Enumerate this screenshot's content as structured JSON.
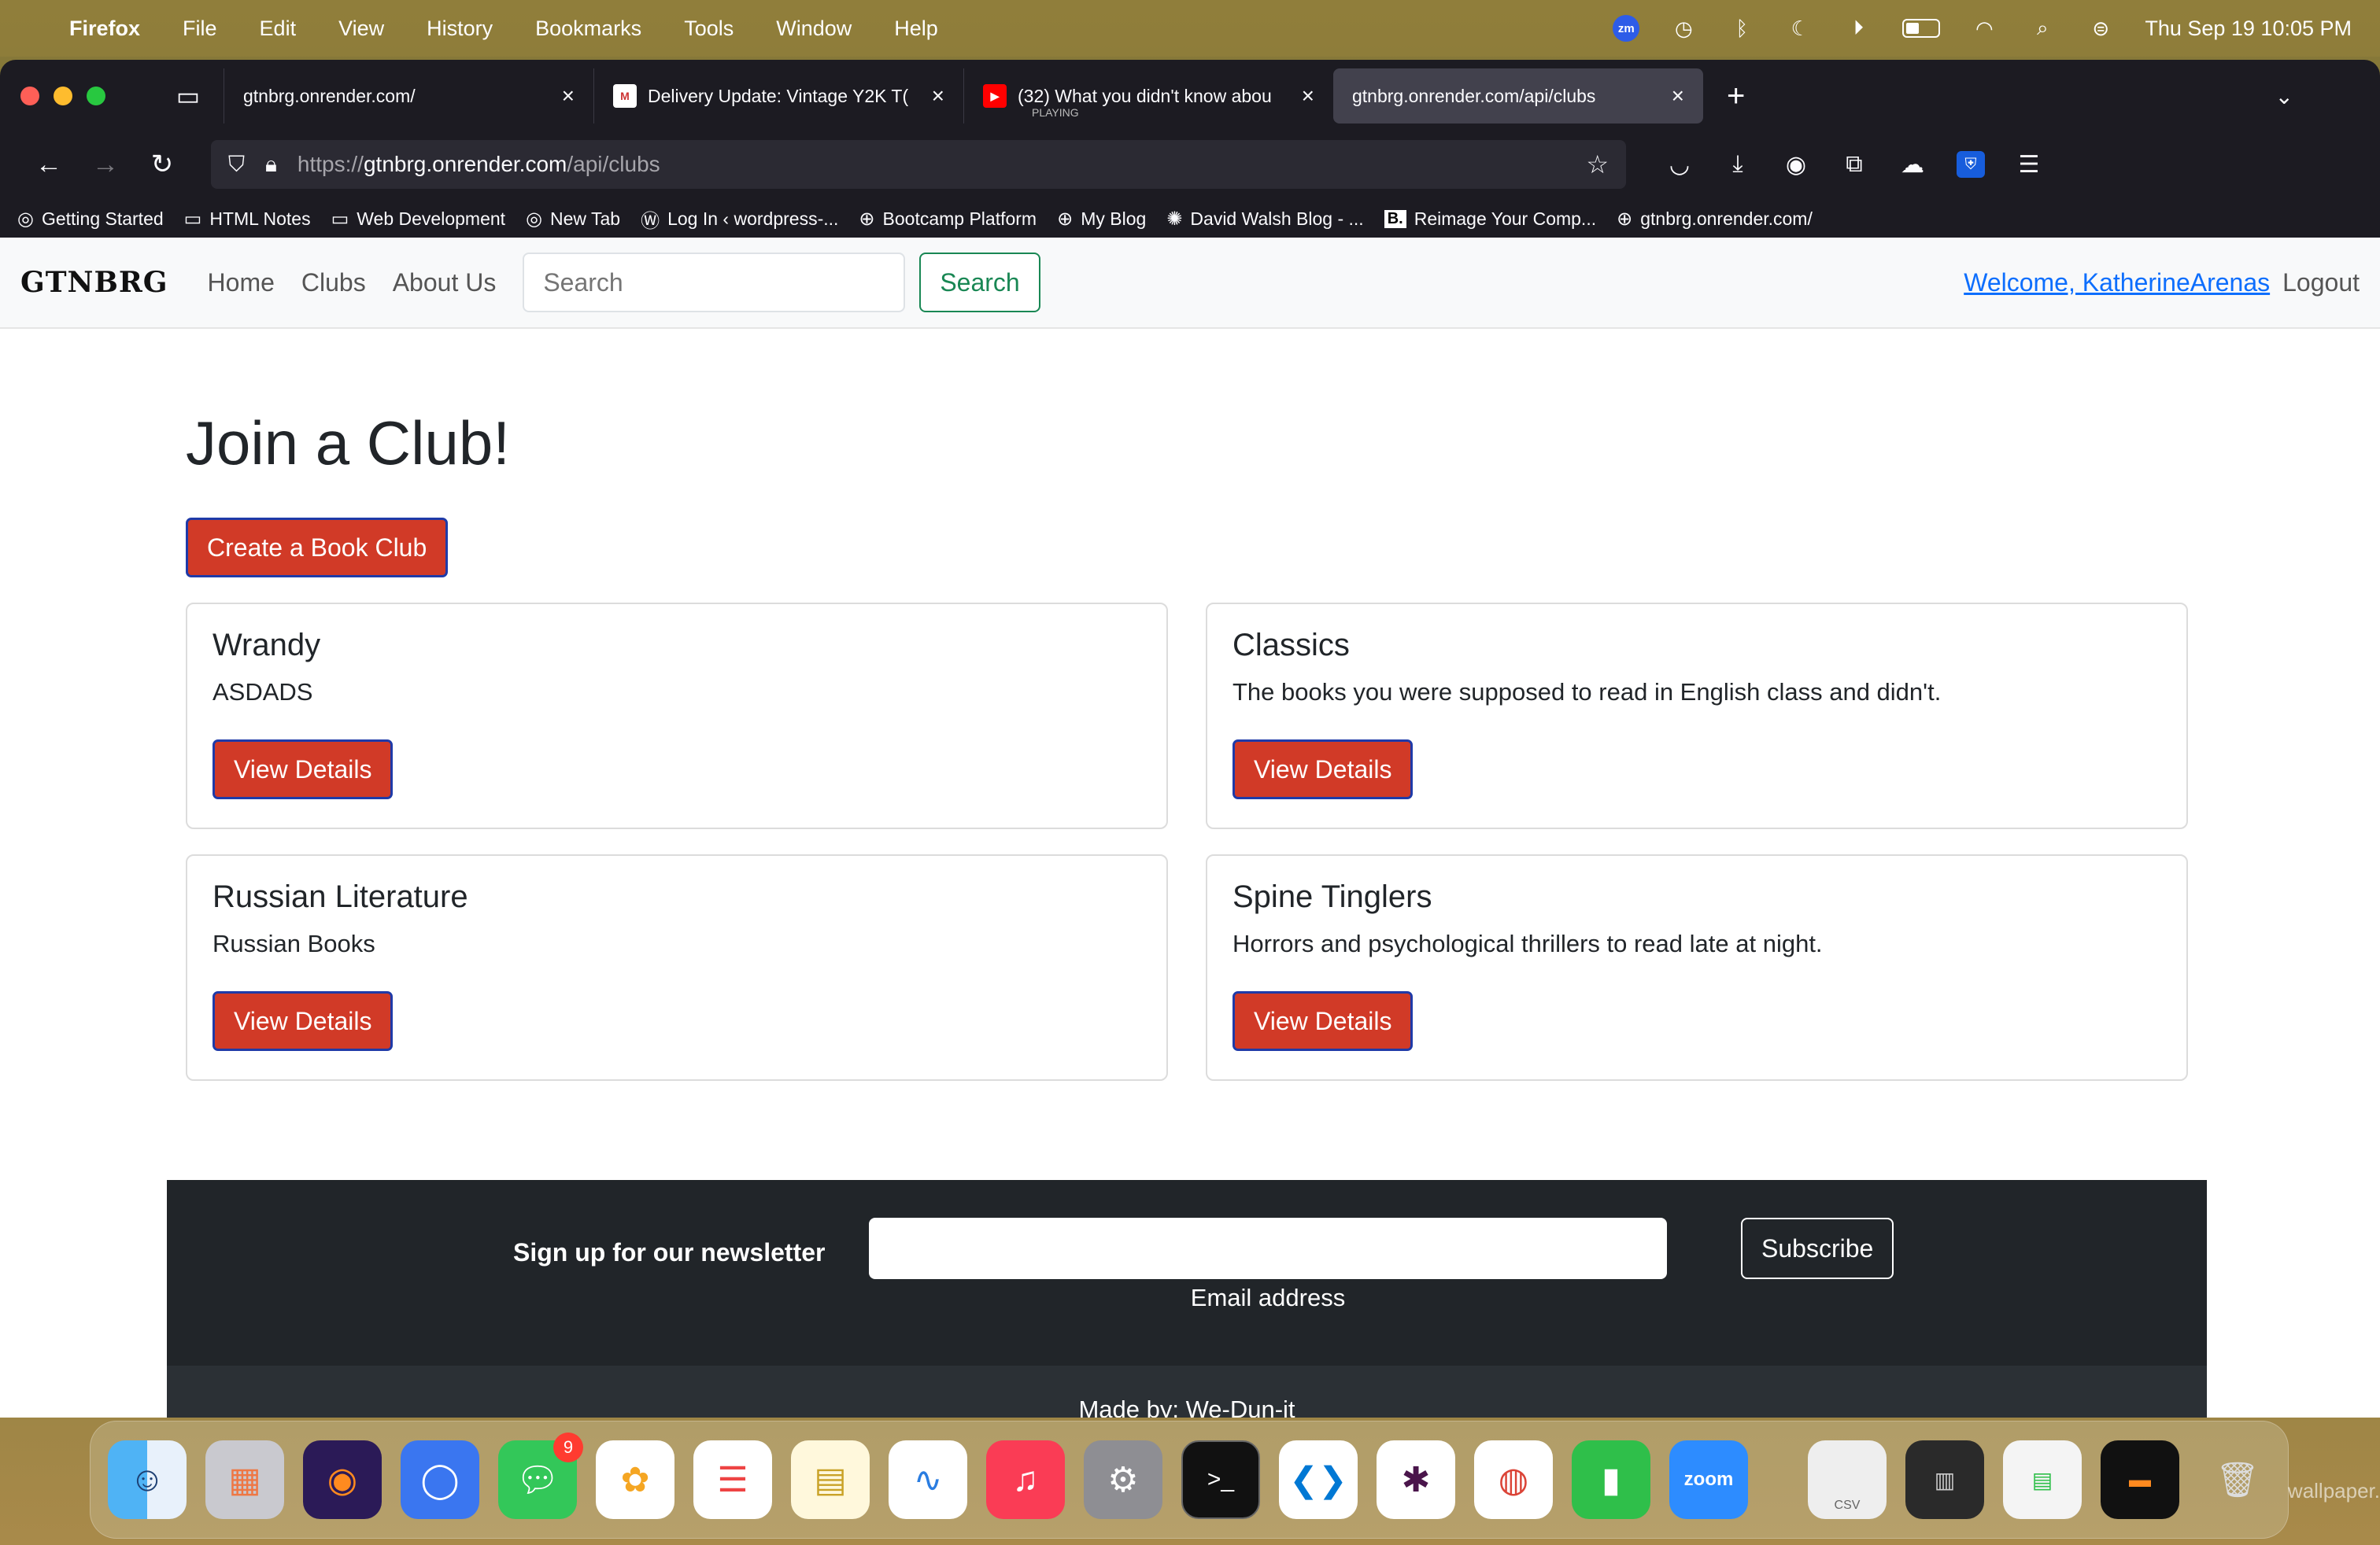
{
  "menubar": {
    "app": "Firefox",
    "items": [
      "File",
      "Edit",
      "View",
      "History",
      "Bookmarks",
      "Tools",
      "Window",
      "Help"
    ],
    "datetime": "Thu Sep 19  10:05 PM",
    "zoom_badge": "zm"
  },
  "browser": {
    "tabs": [
      {
        "title": "gtnbrg.onrender.com/",
        "sub": ""
      },
      {
        "title": "Delivery Update: Vintage Y2K T(",
        "sub": ""
      },
      {
        "title": "(32) What you didn't know abou",
        "sub": "PLAYING"
      },
      {
        "title": "gtnbrg.onrender.com/api/clubs",
        "sub": ""
      }
    ],
    "url": {
      "scheme": "https://",
      "host": "gtnbrg.onrender.com",
      "path": "/api/clubs"
    },
    "bookmarks": [
      "Getting Started",
      "HTML Notes",
      "Web Development",
      "New Tab",
      "Log In ‹ wordpress-...",
      "Bootcamp Platform",
      "My Blog",
      "David Walsh Blog - ...",
      "Reimage Your Comp...",
      "gtnbrg.onrender.com/"
    ]
  },
  "site": {
    "brand": "GTNBRG",
    "nav": {
      "home": "Home",
      "clubs": "Clubs",
      "about": "About Us"
    },
    "search": {
      "placeholder": "Search",
      "button": "Search"
    },
    "welcome": "Welcome, KatherineArenas",
    "logout": "Logout",
    "page_title": "Join a Club!",
    "create_button": "Create a Book Club",
    "clubs": [
      {
        "name": "Wrandy",
        "description": "ASDADS",
        "button": "View Details"
      },
      {
        "name": "Classics",
        "description": "The books you were supposed to read in English class and didn't.",
        "button": "View Details"
      },
      {
        "name": "Russian Literature",
        "description": "Russian Books",
        "button": "View Details"
      },
      {
        "name": "Spine Tinglers",
        "description": "Horrors and psychological thrillers to read late at night.",
        "button": "View Details"
      }
    ],
    "footer": {
      "newsletter_label": "Sign up for our newsletter",
      "email_help": "Email address",
      "subscribe": "Subscribe",
      "made_by": "Made by: We-Dun-it"
    }
  },
  "dock": {
    "messages_badge": "9",
    "zoom_label": "zoom",
    "csv_label": "CSV"
  },
  "wallpaper_label": "wallpaper."
}
